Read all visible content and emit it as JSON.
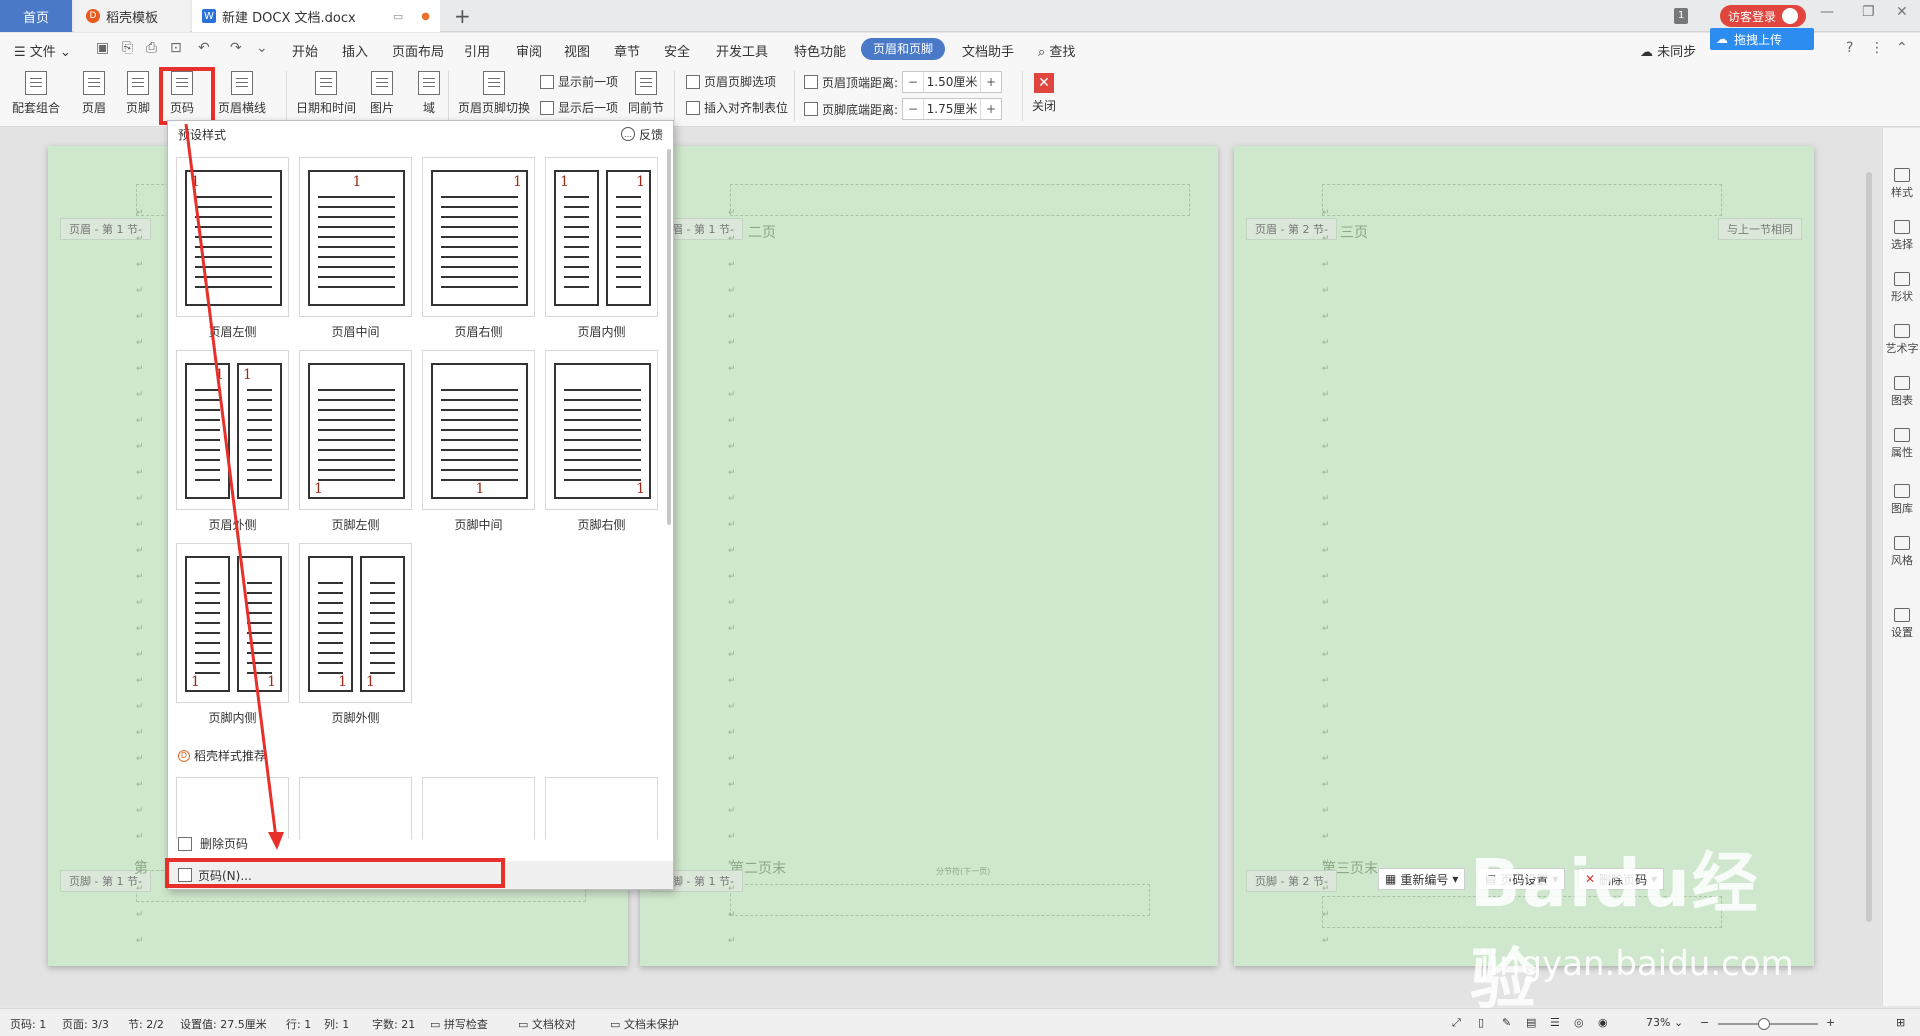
{
  "tabs": {
    "home": "首页",
    "template": "稻壳模板",
    "document": "新建 DOCX 文档.docx"
  },
  "window": {
    "count": "1",
    "login": "访客登录"
  },
  "menu": {
    "file": "文件",
    "items": [
      "开始",
      "插入",
      "页面布局",
      "引用",
      "审阅",
      "视图",
      "章节",
      "安全",
      "开发工具",
      "特色功能"
    ],
    "active": "页眉和页脚",
    "assistant": "文档助手",
    "search": "查找",
    "sync": "未同步",
    "upload": "拖拽上传"
  },
  "ribbon": {
    "combo": "配套组合",
    "header": "页眉",
    "footer": "页脚",
    "page_number": "页码",
    "header_line": "页眉横线",
    "datetime": "日期和时间",
    "picture": "图片",
    "field": "域",
    "switch": "页眉页脚切换",
    "show_prev": "显示前一项",
    "show_next": "显示后一项",
    "same_as_prev": "同前节",
    "hf_options": "页眉页脚选项",
    "insert_align_tab": "插入对齐制表位",
    "header_top_label": "页眉顶端距离:",
    "header_top_value": "1.50厘米",
    "footer_bottom_label": "页脚底端距离:",
    "footer_bottom_value": "1.75厘米",
    "close": "关闭"
  },
  "dropdown": {
    "title": "预设样式",
    "feedback": "反馈",
    "styles": [
      {
        "label": "页眉左侧"
      },
      {
        "label": "页眉中间"
      },
      {
        "label": "页眉右侧"
      },
      {
        "label": "页眉内侧"
      },
      {
        "label": "页眉外侧"
      },
      {
        "label": "页脚左侧"
      },
      {
        "label": "页脚中间"
      },
      {
        "label": "页脚右侧"
      },
      {
        "label": "页脚内侧"
      },
      {
        "label": "页脚外侧"
      }
    ],
    "page_num_digit": "1",
    "recommend": "稻壳样式推荐",
    "delete": "删除页码",
    "page_number_menu": "页码(N)..."
  },
  "pages": [
    {
      "header_label": "页眉 - 第 1 节-",
      "footer_label": "页脚 - 第 1 节-",
      "footer_text": "第"
    },
    {
      "header_label": "页眉 - 第 1 节-",
      "footer_label": "页脚 - 第 1 节-",
      "header_text": "二页",
      "footer_text": "第二页末",
      "break_text": "分节符(下一页)"
    },
    {
      "header_label": "页眉 - 第 2 节-",
      "footer_label": "页脚 - 第 2 节-",
      "header_text": "三页",
      "footer_text": "第三页末",
      "same_as_prev": "与上一节相同"
    }
  ],
  "footer_tools": {
    "renumber": "重新编号",
    "page_settings": "页码设置",
    "delete_page_num": "删除页码"
  },
  "sidebar": [
    "样式",
    "选择",
    "形状",
    "艺术字",
    "图表",
    "属性",
    "图库",
    "风格",
    "设置"
  ],
  "status": {
    "page_num": "页码: 1",
    "pages": "页面: 3/3",
    "section": "节: 2/2",
    "setting": "设置值: 27.5厘米",
    "row": "行: 1",
    "col": "列: 1",
    "words": "字数: 21",
    "spell": "拼写检查",
    "proof": "文档校对",
    "protect": "文档未保护",
    "zoom": "73%"
  },
  "watermark": {
    "brand": "Baidu经验",
    "url": "jingyan.baidu.com"
  }
}
